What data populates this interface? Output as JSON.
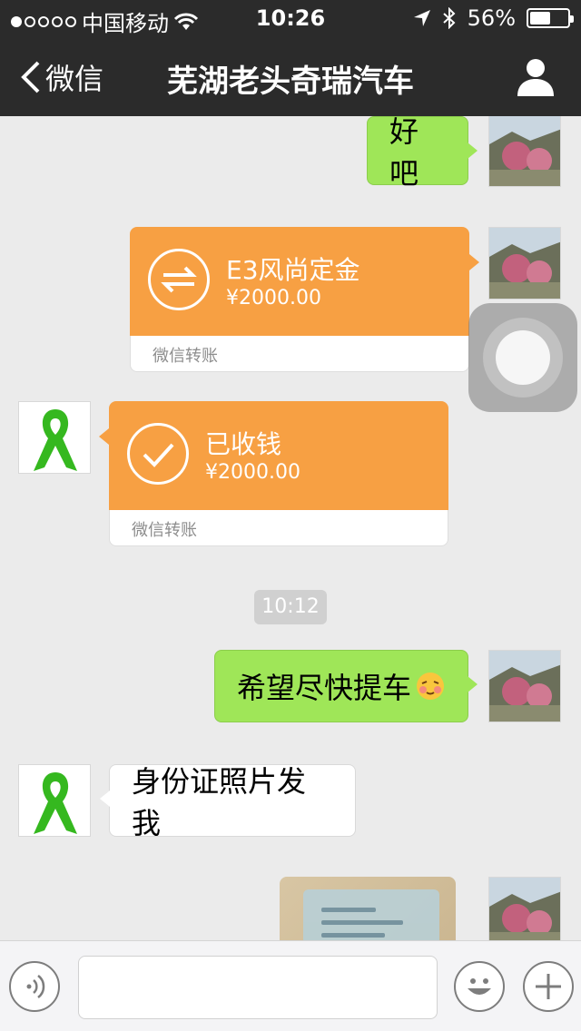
{
  "status_bar": {
    "carrier": "中国移动",
    "time": "10:26",
    "battery_percent": "56%",
    "battery_level": 0.56,
    "signal_dots_filled": 1,
    "signal_dots_total": 5
  },
  "nav": {
    "back_label": "微信",
    "title": "芜湖老头奇瑞汽车"
  },
  "messages": {
    "m1": {
      "text": "好吧"
    },
    "m2": {
      "title": "E3风尚定金",
      "amount": "¥2000.00",
      "footer": "微信转账"
    },
    "m3": {
      "title": "已收钱",
      "amount": "¥2000.00",
      "footer": "微信转账"
    },
    "timestamp": "10:12",
    "m4": {
      "text": "希望尽快提车"
    },
    "m5": {
      "text": "身份证照片发我"
    }
  },
  "input_bar": {
    "placeholder": ""
  },
  "colors": {
    "nav_bg": "#2b2b2b",
    "chat_bg": "#ebebeb",
    "green_bubble": "#9fe658",
    "transfer_orange": "#f7a043"
  },
  "icons": [
    "back-chevron-icon",
    "person-icon",
    "transfer-arrows-icon",
    "checkmark-icon",
    "voice-icon",
    "emoji-icon",
    "plus-icon",
    "wifi-icon",
    "location-arrow-icon",
    "bluetooth-icon"
  ]
}
